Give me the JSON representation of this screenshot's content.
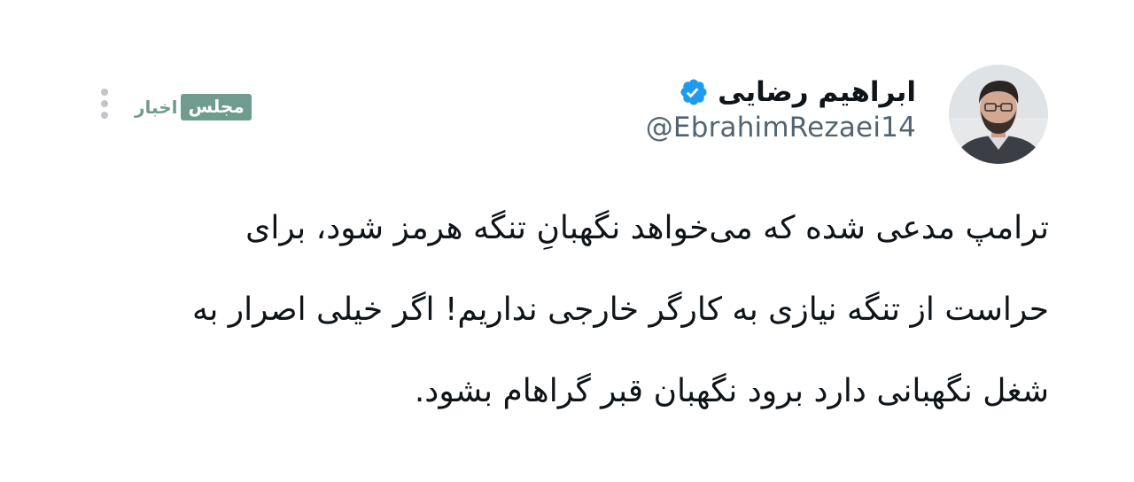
{
  "post": {
    "author": {
      "display_name": "ابراهیم رضایی",
      "handle": "@EbrahimRezaei14",
      "verified": true,
      "verified_color": "#1d9bf0"
    },
    "text_lines": [
      "ترامپ مدعی شده که می‌خواهد نگهبانِ تنگه هرمز شود، برای",
      "حراست از تنگه نیازی به کارگر خارجی نداریم! اگر خیلی اصرار به",
      "شغل نگهبانی دارد برود نگهبان قبر گراهام بشود."
    ]
  },
  "watermark": {
    "word_box": "مجلس",
    "word_plain": "اخبار",
    "color": "#6f9c8e"
  },
  "icons": {
    "menu": "more-vertical-icon",
    "verified": "verified-badge-icon"
  }
}
